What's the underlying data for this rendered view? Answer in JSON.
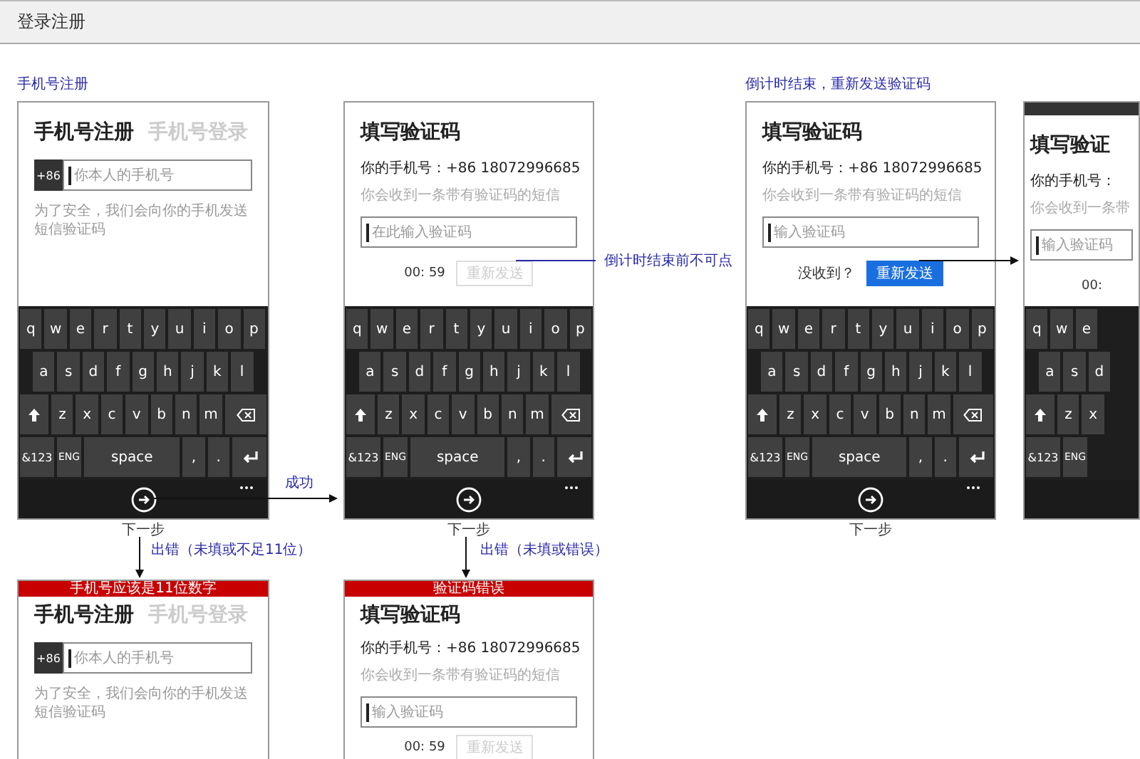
{
  "page_title": "登录注册",
  "screens": [
    {
      "kind": "register",
      "caption": "手机号注册",
      "top_bar": false,
      "tabs": [
        {
          "label": "手机号注册",
          "selected": true
        },
        {
          "label": "手机号登录",
          "selected": false
        }
      ],
      "country_code": "+86",
      "phone_placeholder": "你本人的手机号",
      "hint": "为了安全，我们会向你的手机发送短信验证码",
      "keyboard": {
        "cropped": false,
        "letter_rows": [
          [
            "q",
            "w",
            "e",
            "r",
            "t",
            "y",
            "u",
            "i",
            "o",
            "p"
          ],
          [
            "a",
            "s",
            "d",
            "f",
            "g",
            "h",
            "j",
            "k",
            "l"
          ],
          [
            "z",
            "x",
            "c",
            "v",
            "b",
            "n",
            "m"
          ]
        ],
        "numbers_key": "&123",
        "lang_key": "ENG",
        "space_key": "space",
        "comma_key": ",",
        "period_key": "."
      },
      "next_label": "下一步"
    },
    {
      "kind": "verify",
      "top_bar": false,
      "title": "填写验证码",
      "phone": "你的手机号：+86 18072996685",
      "sms_hint": "你会收到一条带有验证码的短信",
      "code_placeholder": "在此输入验证码",
      "countdown": "00: 59",
      "resend": {
        "label": "重新发送",
        "disabled": true
      },
      "keyboard": {
        "cropped": false,
        "letter_rows": [
          [
            "q",
            "w",
            "e",
            "r",
            "t",
            "y",
            "u",
            "i",
            "o",
            "p"
          ],
          [
            "a",
            "s",
            "d",
            "f",
            "g",
            "h",
            "j",
            "k",
            "l"
          ],
          [
            "z",
            "x",
            "c",
            "v",
            "b",
            "n",
            "m"
          ]
        ],
        "numbers_key": "&123",
        "lang_key": "ENG",
        "space_key": "space",
        "comma_key": ",",
        "period_key": "."
      },
      "next_label": "下一步"
    },
    {
      "kind": "verify",
      "caption": "倒计时结束，重新发送验证码",
      "top_bar": false,
      "title": "填写验证码",
      "phone": "你的手机号：+86 18072996685",
      "sms_hint": "你会收到一条带有验证码的短信",
      "code_placeholder": "输入验证码",
      "not_received": "没收到？",
      "resend": {
        "label": "重新发送",
        "disabled": false
      },
      "keyboard": {
        "cropped": false,
        "letter_rows": [
          [
            "q",
            "w",
            "e",
            "r",
            "t",
            "y",
            "u",
            "i",
            "o",
            "p"
          ],
          [
            "a",
            "s",
            "d",
            "f",
            "g",
            "h",
            "j",
            "k",
            "l"
          ],
          [
            "z",
            "x",
            "c",
            "v",
            "b",
            "n",
            "m"
          ]
        ],
        "numbers_key": "&123",
        "lang_key": "ENG",
        "space_key": "space",
        "comma_key": ",",
        "period_key": "."
      },
      "next_label": "下一步"
    },
    {
      "kind": "verify",
      "top_bar": true,
      "title": "填写验证",
      "phone": "你的手机号：",
      "sms_hint": "你会收到一条带",
      "code_placeholder": "输入验证码",
      "countdown": "00:",
      "keyboard": {
        "cropped": true,
        "letter_rows": [
          [
            "q",
            "w",
            "e"
          ],
          [
            "a",
            "s",
            "d"
          ],
          [
            "z",
            "x"
          ]
        ],
        "numbers_key": "&123",
        "lang_key": "ENG"
      }
    },
    {
      "kind": "register",
      "top_bar": false,
      "error_banner": "手机号应该是11位数字",
      "tabs": [
        {
          "label": "手机号注册",
          "selected": true
        },
        {
          "label": "手机号登录",
          "selected": false
        }
      ],
      "country_code": "+86",
      "phone_placeholder": "你本人的手机号",
      "hint": "为了安全，我们会向你的手机发送短信验证码"
    },
    {
      "kind": "verify",
      "top_bar": false,
      "error_banner": "验证码错误",
      "title": "填写验证码",
      "phone": "你的手机号：+86 18072996685",
      "sms_hint": "你会收到一条带有验证码的短信",
      "code_placeholder": "输入验证码",
      "countdown": "00: 59",
      "resend": {
        "label": "重新发送",
        "disabled": true
      }
    }
  ],
  "annotations": [
    {
      "kind": "leader",
      "text": "倒计时结束前不可点"
    },
    {
      "kind": "arrow",
      "text": "成功"
    },
    {
      "kind": "down",
      "text": "出错（未填或不足11位）"
    },
    {
      "kind": "down",
      "text": "出错（未填或错误）"
    }
  ]
}
